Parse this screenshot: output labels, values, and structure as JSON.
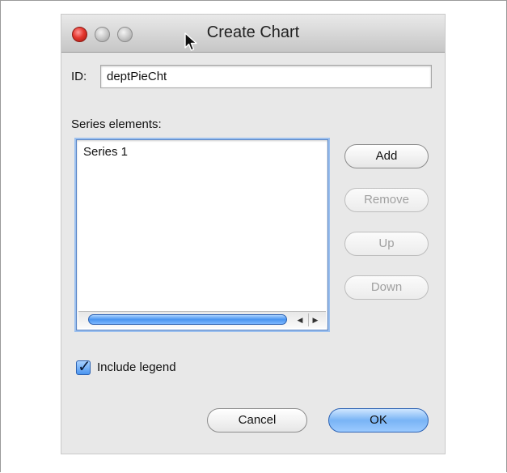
{
  "window": {
    "title": "Create Chart"
  },
  "form": {
    "id_label": "ID:",
    "id_value": "deptPieCht",
    "series_label": "Series elements:",
    "series_items": [
      "Series 1"
    ],
    "include_legend_label": "Include legend",
    "include_legend_checked": true
  },
  "side_buttons": {
    "add": "Add",
    "remove": "Remove",
    "up": "Up",
    "down": "Down"
  },
  "footer": {
    "cancel": "Cancel",
    "ok": "OK"
  },
  "icons": {
    "checkmark": "checkmark-icon",
    "left_arrow": "left-arrow-icon",
    "right_arrow": "right-arrow-icon"
  }
}
